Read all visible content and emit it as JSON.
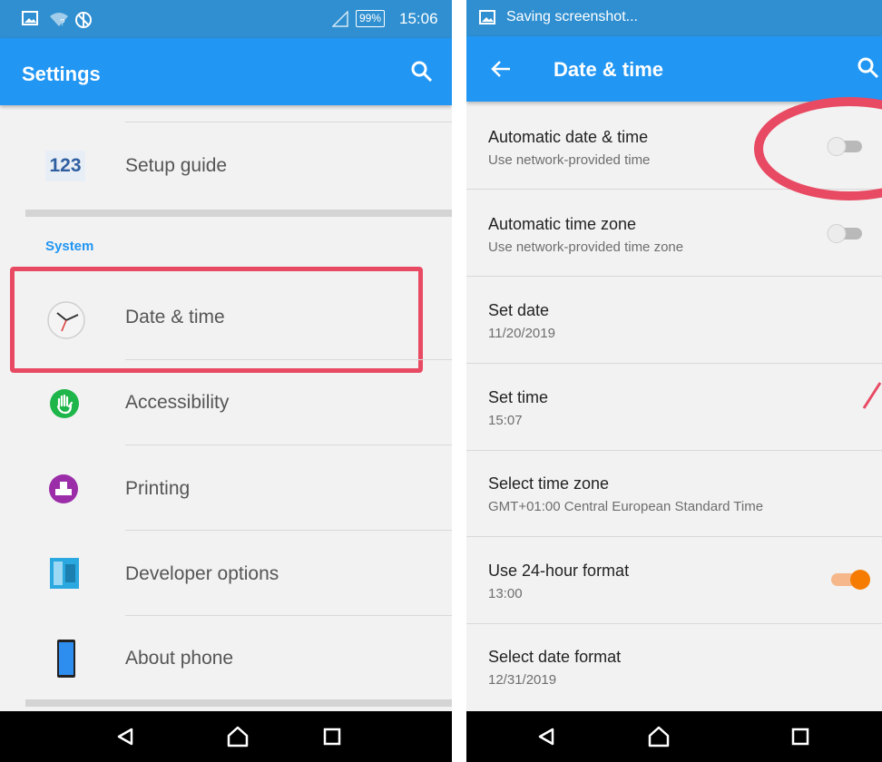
{
  "left": {
    "title": "Settings",
    "status": {
      "time": "15:06",
      "battery": "99%"
    },
    "items": [
      {
        "label": "Setup guide",
        "icon": "setup-guide-icon"
      },
      {
        "label": "Date & time",
        "icon": "clock-icon"
      },
      {
        "label": "Accessibility",
        "icon": "accessibility-icon"
      },
      {
        "label": "Printing",
        "icon": "printer-icon"
      },
      {
        "label": "Developer options",
        "icon": "developer-icon"
      },
      {
        "label": "About phone",
        "icon": "phone-icon"
      }
    ],
    "section": "System",
    "setup_icon_text": "123"
  },
  "right": {
    "status_text": "Saving screenshot...",
    "title": "Date & time",
    "items": [
      {
        "title": "Automatic date & time",
        "sub": "Use network-provided time",
        "toggle": "off"
      },
      {
        "title": "Automatic time zone",
        "sub": "Use network-provided time zone",
        "toggle": "off"
      },
      {
        "title": "Set date",
        "sub": "11/20/2019"
      },
      {
        "title": "Set time",
        "sub": "15:07"
      },
      {
        "title": "Select time zone",
        "sub": "GMT+01:00 Central European Standard Time"
      },
      {
        "title": "Use 24-hour format",
        "sub": "13:00",
        "toggle": "on"
      },
      {
        "title": "Select date format",
        "sub": "12/31/2019"
      }
    ]
  },
  "colors": {
    "accent": "#2196f3",
    "highlight": "#e84a63",
    "toggle_on": "#f57c00"
  }
}
